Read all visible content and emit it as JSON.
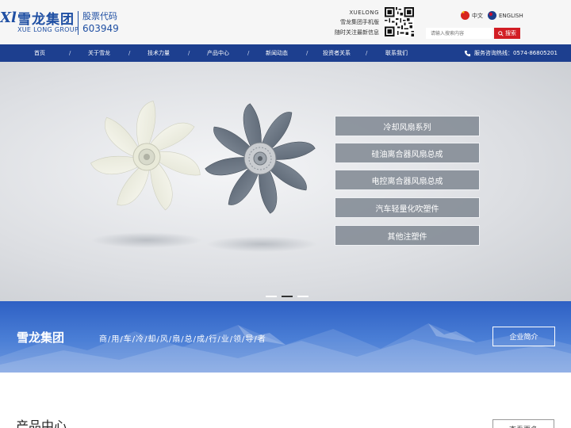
{
  "header": {
    "logo_mark": "Xl",
    "logo_cn": "雪龙集团",
    "logo_en": "XUE LONG GROUP",
    "stock_label": "股票代码",
    "stock_code": "603949",
    "mobile_brand": "XUELONG",
    "mobile_line1": "雪龙集团手机版",
    "mobile_line2": "随时关注最新信息",
    "lang_cn": "中文",
    "lang_en": "ENGLISH",
    "search_placeholder": "请输入搜索内容",
    "search_button": "搜索"
  },
  "nav": {
    "items": [
      "首页",
      "关于雪龙",
      "技术力量",
      "产品中心",
      "新闻动态",
      "投资者关系",
      "联系我们"
    ],
    "separator": "/",
    "hotline": "服务咨询热线：0574-86805201"
  },
  "banner": {
    "menu": [
      "冷却风扇系列",
      "硅油离合器风扇总成",
      "电控离合器风扇总成",
      "汽车轻量化吹塑件",
      "其他注塑件"
    ],
    "active_slide": 2,
    "slide_count": 3
  },
  "band": {
    "title": "雪龙集团",
    "slogan": "商/用/车/冷/却/风/扇/总/成/行/业/领/导/者",
    "button": "企业简介"
  },
  "products": {
    "title": "产品中心",
    "more": "查看更多"
  },
  "colors": {
    "brand_blue": "#1d3f8f",
    "search_red": "#d21d24",
    "band_blue": "#2e60c4"
  }
}
